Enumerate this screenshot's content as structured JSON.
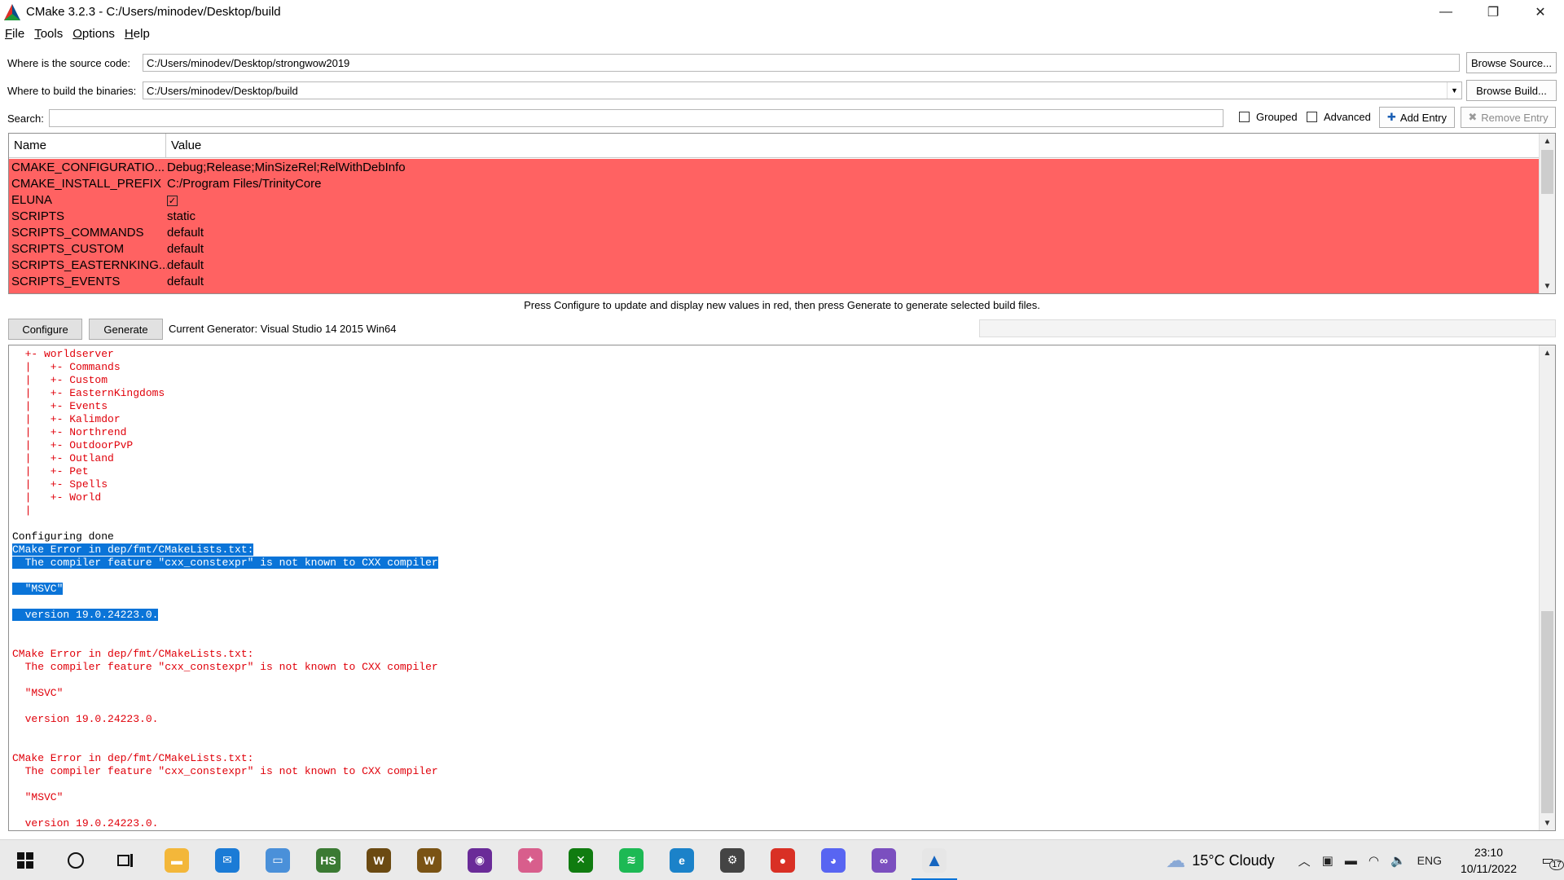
{
  "window": {
    "title": "CMake 3.2.3 - C:/Users/minodev/Desktop/build",
    "minimize": "—",
    "maximize": "❐",
    "close": "✕"
  },
  "menu": [
    "File",
    "Tools",
    "Options",
    "Help"
  ],
  "source": {
    "label": "Where is the source code:",
    "value": "C:/Users/minodev/Desktop/strongwow2019",
    "button": "Browse Source..."
  },
  "binaries": {
    "label": "Where to build the binaries:",
    "value": "C:/Users/minodev/Desktop/build",
    "button": "Browse Build..."
  },
  "search": {
    "label": "Search:",
    "value": "",
    "grouped_label": "Grouped",
    "grouped_checked": false,
    "advanced_label": "Advanced",
    "advanced_checked": false,
    "add_entry": "Add Entry",
    "remove_entry": "Remove Entry"
  },
  "table": {
    "headers": [
      "Name",
      "Value"
    ],
    "rows": [
      {
        "name": "CMAKE_CONFIGURATIO...",
        "value": "Debug;Release;MinSizeRel;RelWithDebInfo"
      },
      {
        "name": "CMAKE_INSTALL_PREFIX",
        "value": "C:/Program Files/TrinityCore"
      },
      {
        "name": "ELUNA",
        "value": "",
        "checkbox": true
      },
      {
        "name": "SCRIPTS",
        "value": "static"
      },
      {
        "name": "SCRIPTS_COMMANDS",
        "value": "default"
      },
      {
        "name": "SCRIPTS_CUSTOM",
        "value": "default"
      },
      {
        "name": "SCRIPTS_EASTERNKING...",
        "value": "default"
      },
      {
        "name": "SCRIPTS_EVENTS",
        "value": "default"
      }
    ],
    "row_color": "#ff6262"
  },
  "hint": "Press Configure to update and display new values in red, then press Generate to generate selected build files.",
  "actions": {
    "configure": "Configure",
    "generate": "Generate",
    "generator": "Current Generator: Visual Studio 14 2015 Win64"
  },
  "output": {
    "lines": [
      {
        "text": "  +- worldserver",
        "color": "red"
      },
      {
        "text": "  |   +- Commands",
        "color": "red"
      },
      {
        "text": "  |   +- Custom",
        "color": "red"
      },
      {
        "text": "  |   +- EasternKingdoms",
        "color": "red"
      },
      {
        "text": "  |   +- Events",
        "color": "red"
      },
      {
        "text": "  |   +- Kalimdor",
        "color": "red"
      },
      {
        "text": "  |   +- Northrend",
        "color": "red"
      },
      {
        "text": "  |   +- OutdoorPvP",
        "color": "red"
      },
      {
        "text": "  |   +- Outland",
        "color": "red"
      },
      {
        "text": "  |   +- Pet",
        "color": "red"
      },
      {
        "text": "  |   +- Spells",
        "color": "red"
      },
      {
        "text": "  |   +- World",
        "color": "red"
      },
      {
        "text": "  |",
        "color": "red"
      },
      {
        "text": "",
        "color": "black"
      },
      {
        "text": "Configuring done",
        "color": "black"
      },
      {
        "text": "CMake Error in dep/fmt/CMakeLists.txt:",
        "color": "red",
        "highlight": true
      },
      {
        "text": "  The compiler feature \"cxx_constexpr\" is not known to CXX compiler",
        "color": "red",
        "highlight": true
      },
      {
        "text": "",
        "color": "red"
      },
      {
        "text": "  \"MSVC\"",
        "color": "red",
        "highlight": true
      },
      {
        "text": "",
        "color": "red"
      },
      {
        "text": "  version 19.0.24223.0.",
        "color": "red",
        "highlight": true
      },
      {
        "text": "",
        "color": "red"
      },
      {
        "text": "",
        "color": "red"
      },
      {
        "text": "CMake Error in dep/fmt/CMakeLists.txt:",
        "color": "red"
      },
      {
        "text": "  The compiler feature \"cxx_constexpr\" is not known to CXX compiler",
        "color": "red"
      },
      {
        "text": "",
        "color": "red"
      },
      {
        "text": "  \"MSVC\"",
        "color": "red"
      },
      {
        "text": "",
        "color": "red"
      },
      {
        "text": "  version 19.0.24223.0.",
        "color": "red"
      },
      {
        "text": "",
        "color": "red"
      },
      {
        "text": "",
        "color": "red"
      },
      {
        "text": "CMake Error in dep/fmt/CMakeLists.txt:",
        "color": "red"
      },
      {
        "text": "  The compiler feature \"cxx_constexpr\" is not known to CXX compiler",
        "color": "red"
      },
      {
        "text": "",
        "color": "red"
      },
      {
        "text": "  \"MSVC\"",
        "color": "red"
      },
      {
        "text": "",
        "color": "red"
      },
      {
        "text": "  version 19.0.24223.0.",
        "color": "red"
      }
    ]
  },
  "taskbar": {
    "apps": [
      {
        "name": "file-explorer-icon",
        "color": "#f3b73a",
        "glyph": "▬"
      },
      {
        "name": "mail-icon",
        "color": "#1b7bd6",
        "glyph": "✉"
      },
      {
        "name": "this-pc-icon",
        "color": "#4a90d9",
        "glyph": "▭"
      },
      {
        "name": "hearthstone-icon",
        "color": "#3b7a33",
        "glyph": "HS"
      },
      {
        "name": "wow-icon",
        "color": "#6b4a12",
        "glyph": "W"
      },
      {
        "name": "wow-classic-icon",
        "color": "#7a5314",
        "glyph": "W"
      },
      {
        "name": "podcast-icon",
        "color": "#6a2b98",
        "glyph": "◉"
      },
      {
        "name": "tool-icon",
        "color": "#d85e8c",
        "glyph": "✦"
      },
      {
        "name": "xbox-icon",
        "color": "#107c10",
        "glyph": "✕"
      },
      {
        "name": "spotify-icon",
        "color": "#1db954",
        "glyph": "≋"
      },
      {
        "name": "edge-icon",
        "color": "#1b82c9",
        "glyph": "e"
      },
      {
        "name": "settings-icon",
        "color": "#444444",
        "glyph": "⚙"
      },
      {
        "name": "chrome-icon",
        "color": "#d93025",
        "glyph": "●"
      },
      {
        "name": "discord-icon",
        "color": "#5865f2",
        "glyph": "◕"
      },
      {
        "name": "visual-studio-icon",
        "color": "#7b4fbf",
        "glyph": "∞"
      },
      {
        "name": "cmake-icon",
        "color": "#e6e6e6",
        "glyph": "▲",
        "active": true
      }
    ],
    "weather": "15°C  Cloudy",
    "language": "ENG",
    "time": "23:10",
    "date": "10/11/2022",
    "notifications": "17"
  }
}
